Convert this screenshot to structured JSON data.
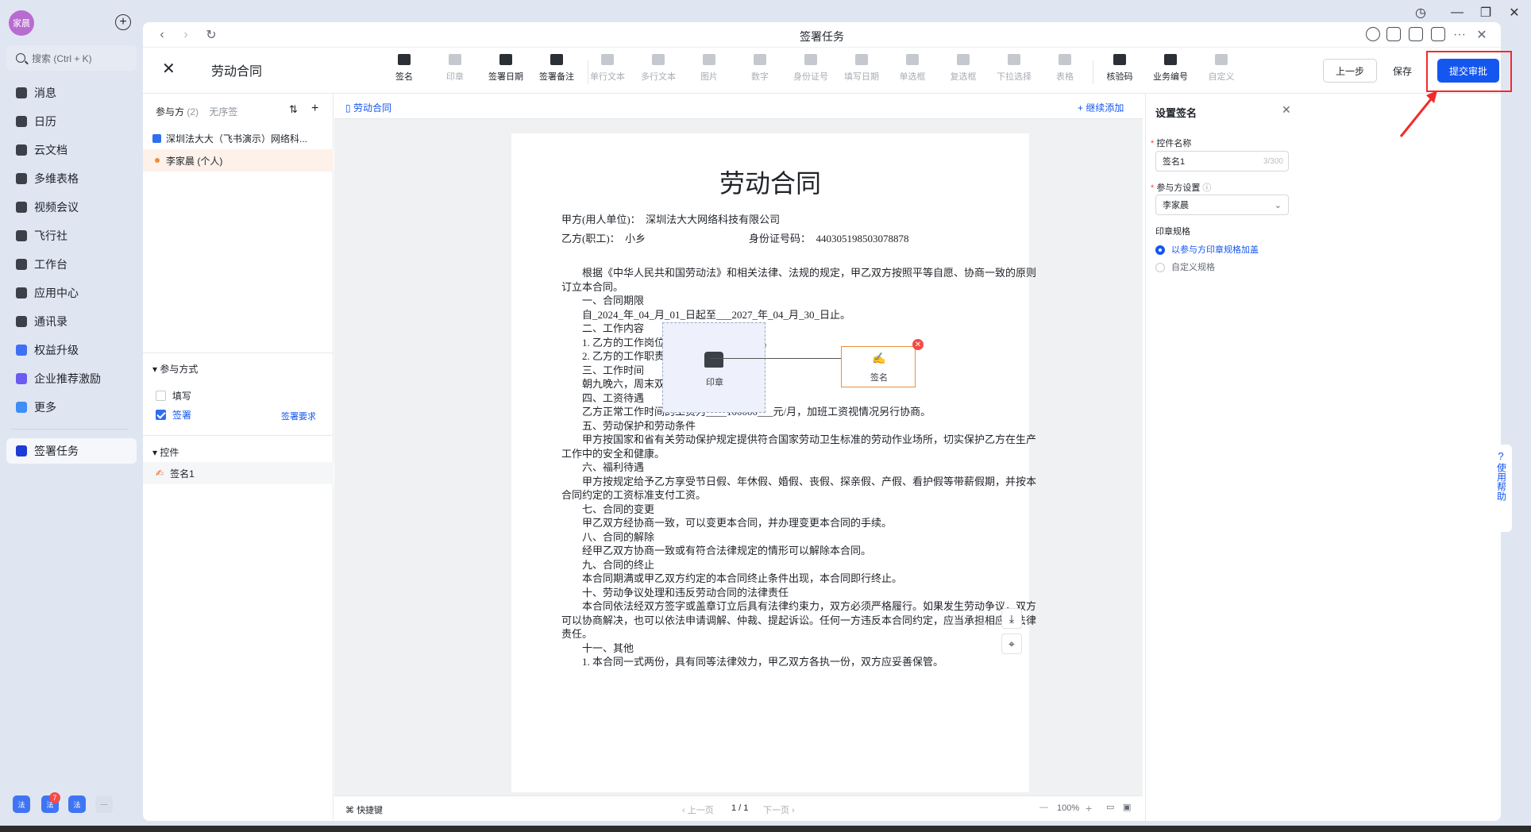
{
  "app": {
    "avatar_text": "家晨",
    "search_placeholder": "搜索 (Ctrl + K)",
    "nav": [
      "消息",
      "日历",
      "云文档",
      "多维表格",
      "视频会议",
      "飞行社",
      "工作台",
      "应用中心",
      "通讯录",
      "权益升级",
      "企业推荐激励",
      "更多"
    ],
    "active_nav": "签署任务",
    "dock_badge": "7"
  },
  "window": {
    "title": "签署任务"
  },
  "toolbar": {
    "doc_title": "劳动合同",
    "tools": [
      "签名",
      "印章",
      "签署日期",
      "签署备注",
      "单行文本",
      "多行文本",
      "图片",
      "数字",
      "身份证号",
      "填写日期",
      "单选框",
      "复选框",
      "下拉选择",
      "表格",
      "核验码",
      "业务编号",
      "自定义"
    ],
    "prev_label": "上一步",
    "save_label": "保存",
    "submit_label": "提交审批"
  },
  "left_panel": {
    "tab_participants": "参与方",
    "participant_count": "(2)",
    "tab_no_order": "无序签",
    "participants": [
      "深圳法大大（飞书演示）网络科...",
      "李家晨 (个人)"
    ],
    "mode_heading": "参与方式",
    "mode_fill": "填写",
    "mode_sign": "签署",
    "sign_requirement": "签署要求",
    "controls_heading": "控件",
    "control_item": "签名1"
  },
  "center": {
    "doc_tab": "劳动合同",
    "continue_add": "+ 继续添加",
    "stamp_label": "印章",
    "sign_label": "签名",
    "shortcut": "快捷键",
    "prev_page": "上一页",
    "page_indicator": "1 / 1",
    "next_page": "下一页",
    "zoom": "100%"
  },
  "document": {
    "heading": "劳动合同",
    "lines": [
      "甲方(用人单位)：　深圳法大大网络科技有限公司",
      "乙方(职工)：　小乡",
      "身份证号码：　440305198503078878",
      "　　根据《中华人民共和国劳动法》和相关法律、法规的规定，甲乙双方按照平等自愿、协商一致的原则",
      "订立本合同。",
      "　　一、合同期限",
      "　　自_2024_年_04_月_01_日起至___2027_年_04_月_30_日止。",
      "　　二、工作内容",
      "　　1. 乙方的工作岗位为____工程师_______。",
      "　　2. 乙方的工作职责_____后端开发",
      "　　三、工作时间",
      "　　朝九晚六，周末双休。",
      "　　四、工资待遇",
      "　　乙方正常工作时间的工资为____100000___元/月，加班工资视情况另行协商。",
      "　　五、劳动保护和劳动条件",
      "　　甲方按国家和省有关劳动保护规定提供符合国家劳动卫生标准的劳动作业场所，切实保护乙方在生产",
      "工作中的安全和健康。",
      "　　六、福利待遇",
      "　　甲方按规定给予乙方享受节日假、年休假、婚假、丧假、探亲假、产假、看护假等带薪假期，并按本",
      "合同约定的工资标准支付工资。",
      "　　七、合同的变更",
      "　　甲乙双方经协商一致，可以变更本合同，并办理变更本合同的手续。",
      "　　八、合同的解除",
      "　　经甲乙双方协商一致或有符合法律规定的情形可以解除本合同。",
      "　　九、合同的终止",
      "　　本合同期满或甲乙双方约定的本合同终止条件出现，本合同即行终止。",
      "　　十、劳动争议处理和违反劳动合同的法律责任",
      "　　本合同依法经双方签字或盖章订立后具有法律约束力，双方必须严格履行。如果发生劳动争议，双方",
      "可以协商解决，也可以依法申请调解、仲裁、提起诉讼。任何一方违反本合同约定，应当承担相应的法律",
      "责任。",
      "　　十一、其他",
      "　　1. 本合同一式两份，具有同等法律效力，甲乙双方各执一份，双方应妥善保管。"
    ]
  },
  "right_panel": {
    "title": "设置签名",
    "name_label": "控件名称",
    "name_value": "签名1",
    "name_count": "3/300",
    "party_label": "参与方设置",
    "party_value": "李家晨",
    "spec_label": "印章规格",
    "spec_option1": "以参与方印章规格加盖",
    "spec_option2": "自定义规格"
  },
  "help": {
    "label": "使用帮助"
  }
}
